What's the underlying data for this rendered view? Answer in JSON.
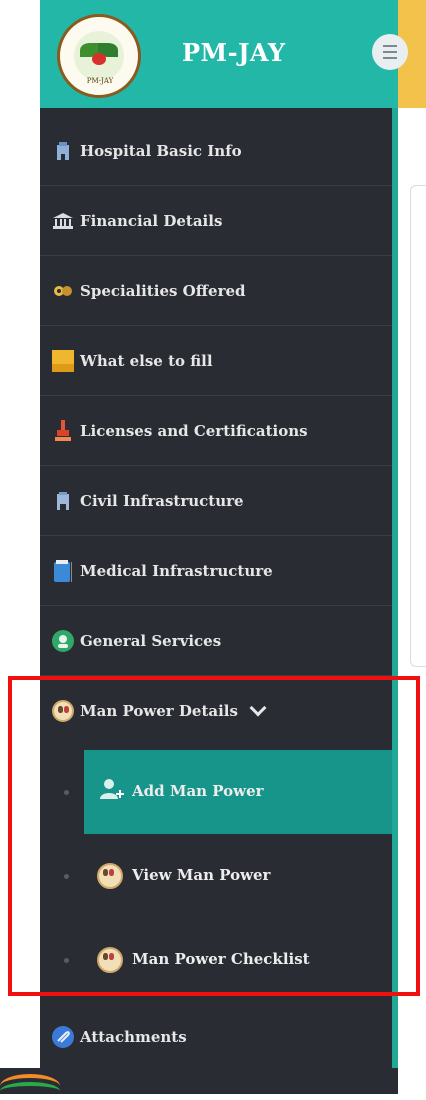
{
  "header": {
    "brand": "PM-JAY",
    "logo_text": "PM-JAY"
  },
  "sidebar": {
    "items": [
      {
        "label": "Hospital Basic Info",
        "icon": "hospital-icon"
      },
      {
        "label": "Financial Details",
        "icon": "bank-icon"
      },
      {
        "label": "Specialities Offered",
        "icon": "specialities-icon"
      },
      {
        "label": "What else to fill",
        "icon": "folder-icon"
      },
      {
        "label": "Licenses and Certifications",
        "icon": "stamp-icon"
      },
      {
        "label": "Civil Infrastructure",
        "icon": "building-icon"
      },
      {
        "label": "Medical Infrastructure",
        "icon": "medical-icon"
      },
      {
        "label": "General Services",
        "icon": "services-icon"
      },
      {
        "label": "Man Power Details",
        "icon": "manpower-icon"
      }
    ],
    "submenu": [
      {
        "label": "Add Man Power",
        "icon": "add-user-icon",
        "active": true
      },
      {
        "label": "View Man Power",
        "icon": "manpower-icon",
        "active": false
      },
      {
        "label": "Man Power Checklist",
        "icon": "manpower-icon",
        "active": false
      }
    ],
    "after": {
      "label": "Attachments",
      "icon": "attachment-icon"
    }
  },
  "colors": {
    "header": "#22b7a6",
    "sidebar": "#2a2c33",
    "active": "#17958a",
    "highlight": "#f01010"
  }
}
